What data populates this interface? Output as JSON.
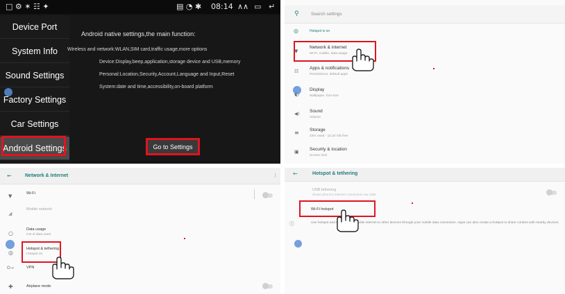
{
  "panel1": {
    "status": {
      "left_icons": "□  ⚙ ✶ ☷ ✦",
      "right_icons": "▤ ◔ ✱",
      "time": "08:14",
      "up_icon": "∧∧",
      "window_icon": "▭",
      "back_icon": "↵"
    },
    "sidebar": [
      {
        "label": "Device Port"
      },
      {
        "label": "System Info"
      },
      {
        "label": "Sound Settings"
      },
      {
        "label": "Factory Settings"
      },
      {
        "label": "Car Settings"
      },
      {
        "label": "Android Settings"
      }
    ],
    "content": {
      "title": "Android native settings,the main function:",
      "lines": [
        "Wireless and network:WLAN,SIM card,traffic usage,more options",
        "Device:Display,beep,application,storage device and USB,memory",
        "Personal:Location,Security,Account,Language and Input,Reset",
        "System:date and time,accessibility,on-board platform"
      ],
      "button": "Go to Settings"
    }
  },
  "panel2": {
    "search_placeholder": "Search settings",
    "hotspot_banner": "Hotspot is on",
    "items": [
      {
        "label": "Network & internet",
        "sub": "Wi-Fi, mobile, data usage",
        "icon": "wifi-icon",
        "glyph": "▼"
      },
      {
        "label": "Apps & notifications",
        "sub": "Permissions, default apps",
        "icon": "apps-icon",
        "glyph": "☷"
      },
      {
        "label": "Display",
        "sub": "Wallpaper, font size",
        "icon": "display-icon",
        "glyph": "◐"
      },
      {
        "label": "Sound",
        "sub": "Volume",
        "icon": "sound-icon",
        "glyph": "◀)"
      },
      {
        "label": "Storage",
        "sub": "23% used - 12.34 GB free",
        "icon": "storage-icon",
        "glyph": "≡"
      },
      {
        "label": "Security & location",
        "sub": "Screen lock",
        "icon": "lock-icon",
        "glyph": "▣"
      }
    ]
  },
  "panel3": {
    "title": "Network & Internet",
    "items": [
      {
        "label": "Wi-Fi",
        "sub": "",
        "icon": "wifi-icon",
        "glyph": "▼"
      },
      {
        "label": "Mobile network",
        "sub": "",
        "icon": "signal-icon",
        "glyph": "◢"
      },
      {
        "label": "Data usage",
        "sub": "0 B of data used",
        "icon": "data-usage-icon",
        "glyph": "○"
      },
      {
        "label": "Hotspot & tethering",
        "sub": "Hotspot on",
        "icon": "hotspot-icon",
        "glyph": "◎"
      },
      {
        "label": "VPN",
        "sub": "",
        "icon": "vpn-icon",
        "glyph": "O→"
      },
      {
        "label": "Airplane mode",
        "sub": "",
        "icon": "airplane-icon",
        "glyph": "✚"
      }
    ]
  },
  "panel4": {
    "title": "Hotspot & tethering",
    "usb_label": "USB tethering",
    "usb_sub": "Share phone's internet connection via USB",
    "wifi_hotspot": "Wi-Fi hotspot",
    "info_text": "Use hotspot and tethering to provide internet to other devices through your mobile data connection. Apps can also create a hotspot to share content with nearby devices."
  }
}
